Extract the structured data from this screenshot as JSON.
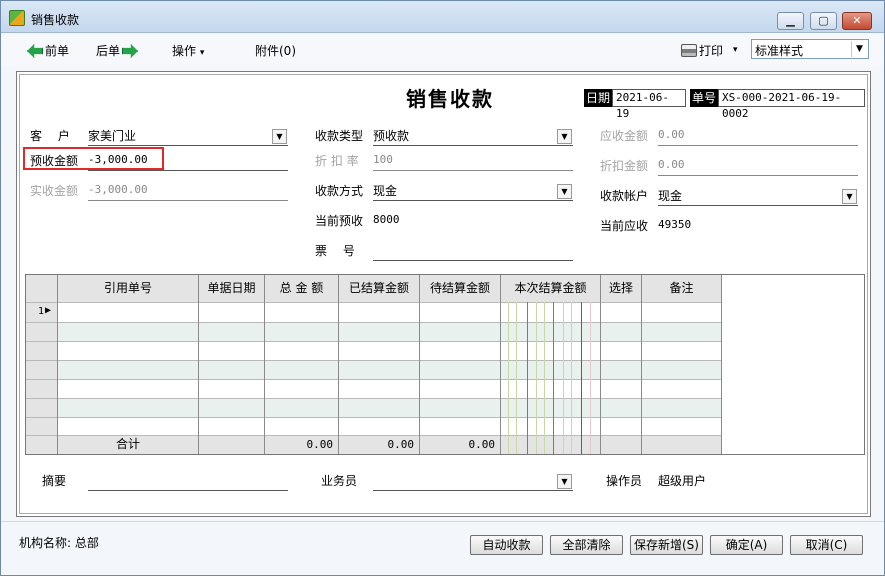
{
  "window": {
    "title": "销售收款",
    "minimize": "▁",
    "maximize": "▢",
    "close": "✕"
  },
  "toolbar": {
    "prev": "前单",
    "next": "后单",
    "operate": "操作",
    "operate_arrow": "▾",
    "attach": "附件(0)",
    "print": "打印",
    "print_arrow": "▾",
    "style_value": "标准样式",
    "dropdown_glyph": "▼"
  },
  "doc": {
    "title": "销售收款",
    "date_label": "日期",
    "date_value": "2021-06-19",
    "no_label": "单号",
    "no_value": "XS-000-2021-06-19-0002"
  },
  "form": {
    "customer_label": "客　 户",
    "customer_value": "家美门业",
    "prepaid_label": "预收金额",
    "prepaid_value": "-3,000.00",
    "actual_label": "实收金额",
    "actual_value": "-3,000.00",
    "type_label": "收款类型",
    "type_value": "预收款",
    "discount_rate_label": "折 扣 率",
    "discount_rate_value": "100",
    "method_label": "收款方式",
    "method_value": "现金",
    "cur_prepaid_label": "当前预收",
    "cur_prepaid_value": "8000",
    "ticket_label": "票　 号",
    "ticket_value": "",
    "receivable_label": "应收金额",
    "receivable_value": "0.00",
    "discount_amt_label": "折扣金额",
    "discount_amt_value": "0.00",
    "account_label": "收款帐户",
    "account_value": "现金",
    "cur_receivable_label": "当前应收",
    "cur_receivable_value": "49350"
  },
  "grid": {
    "columns": [
      "引用单号",
      "单据日期",
      "总 金 额",
      "已结算金额",
      "待结算金额",
      "本次结算金额",
      "选择",
      "备注"
    ],
    "row_numbers": [
      "1",
      "",
      "",
      "",
      "",
      "",
      ""
    ],
    "row_marker": "▶",
    "total_label": "合计",
    "total_amount": "0.00",
    "total_settled": "0.00",
    "total_pending": "0.00"
  },
  "footer": {
    "summary_label": "摘要",
    "summary_value": "",
    "staff_label": "业务员",
    "staff_value": "",
    "operator_label": "操作员",
    "operator_value": "超级用户"
  },
  "status": {
    "org": "机构名称: 总部",
    "auto": "自动收款",
    "clear": "全部清除",
    "save_new": "保存新增(S)",
    "ok": "确定(A)",
    "cancel": "取消(C)"
  },
  "colors": {
    "highlight_box": "#e02a2a",
    "row_stripe": "#e8f1ee",
    "settle_marker": "#e02a2a"
  }
}
